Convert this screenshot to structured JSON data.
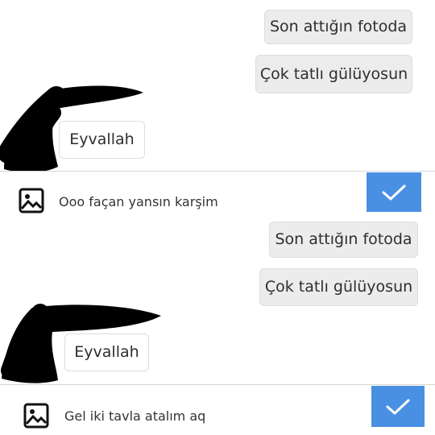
{
  "colors": {
    "accent": "#4a90e2",
    "sent_bubble": "#ececec",
    "received_bubble": "#ffffff",
    "scribble": "#000000"
  },
  "screenshot_1": {
    "messages": [
      {
        "text": "Son attığın fotoda",
        "direction": "sent"
      },
      {
        "text": "Çok tatlı gülüyosun",
        "direction": "sent"
      },
      {
        "text": "Eyvallah",
        "direction": "received"
      }
    ],
    "reply": {
      "icon": "image-icon",
      "text": "Ooo façan yansın karşim",
      "send_icon": "checkmark-icon"
    }
  },
  "screenshot_2": {
    "messages": [
      {
        "text": "Son attığın fotoda",
        "direction": "sent"
      },
      {
        "text": "Çok tatlı gülüyosun",
        "direction": "sent"
      },
      {
        "text": "Eyvallah",
        "direction": "received"
      }
    ],
    "reply": {
      "icon": "image-icon",
      "text": "Gel iki tavla atalım aq",
      "send_icon": "checkmark-icon"
    }
  }
}
